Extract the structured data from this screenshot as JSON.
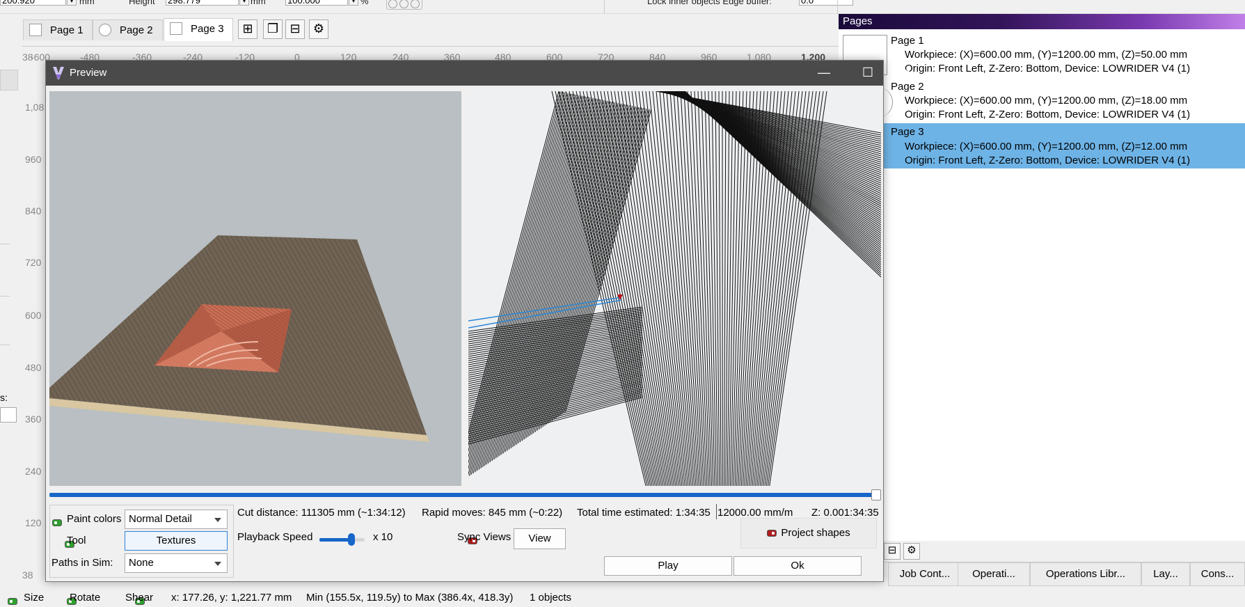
{
  "top_toolbar": {
    "x_value": "200.920",
    "x_unit": "mm",
    "height_label": "Height",
    "height_value": "298.779",
    "height_unit": "mm",
    "scale_value": "100.000",
    "scale_unit": "%",
    "lock_label": "Lock inner objects Edge buffer:",
    "lock_value": "0.0"
  },
  "page_tabs": [
    {
      "label": "Page 1"
    },
    {
      "label": "Page 2"
    },
    {
      "label": "Page 3"
    }
  ],
  "page_tab_buttons": [
    {
      "icon": "add-page-icon"
    },
    {
      "icon": "duplicate-page-icon"
    },
    {
      "icon": "remove-page-icon"
    },
    {
      "icon": "page-settings-icon"
    }
  ],
  "ruler": {
    "h_ticks": [
      "-600",
      "-480",
      "-360",
      "-240",
      "-120",
      "0",
      "120",
      "240",
      "360",
      "480",
      "600",
      "720",
      "840",
      "960",
      "1,080",
      "1,200"
    ],
    "v_ticks": [
      "1,08",
      "960",
      "840",
      "720",
      "600",
      "480",
      "360",
      "240",
      "120"
    ],
    "corner": "38",
    "bottom_corner": "38"
  },
  "left_fragment": {
    "label": "s:"
  },
  "preview": {
    "title": "Preview",
    "window_controls": {
      "minimize": "—",
      "maximize": "☐",
      "close": "✕"
    },
    "paint_colors_label": "Paint colors",
    "paint_colors_value": "Normal Detail",
    "tool_label": "Tool",
    "textures_button": "Textures",
    "paths_in_sim_label": "Paths in Sim:",
    "paths_in_sim_value": "None",
    "cut_distance": "Cut distance: 111305 mm (~1:34:12)",
    "rapid_moves": "Rapid moves: 845 mm (~0:22)",
    "total_time": "Total time estimated: 1:34:35",
    "feed_rate": "12000.00 mm/m",
    "z_readout": "Z: 0.001:34:35",
    "playback_speed_label": "Playback Speed",
    "playback_speed_value": "x 10",
    "playback_speed_level": 0.7,
    "sync_views_label": "Sync Views",
    "view_button": "View",
    "project_shapes_button": "Project shapes",
    "play_button": "Play",
    "ok_button": "Ok",
    "progress": 1.0,
    "colors": {
      "wood": "#6e6152",
      "pocket": "#c96f56",
      "accent": "#1766c9"
    }
  },
  "pages_panel": {
    "title": "Pages",
    "pages": [
      {
        "name": "Page 1",
        "workpiece": "Workpiece: (X)=600.00 mm, (Y)=1200.00 mm, (Z)=50.00 mm",
        "origin": "Origin: Front Left, Z-Zero: Bottom, Device: LOWRIDER V4 (1)",
        "selected": false
      },
      {
        "name": "Page 2",
        "workpiece": "Workpiece: (X)=600.00 mm, (Y)=1200.00 mm, (Z)=18.00 mm",
        "origin": "Origin: Front Left, Z-Zero: Bottom, Device: LOWRIDER V4 (1)",
        "selected": false
      },
      {
        "name": "Page 3",
        "workpiece": "Workpiece: (X)=600.00 mm, (Y)=1200.00 mm, (Z)=12.00 mm",
        "origin": "Origin: Front Left, Z-Zero: Bottom, Device: LOWRIDER V4 (1)",
        "selected": true
      }
    ]
  },
  "bottom_tabs": [
    {
      "label": "Job Cont..."
    },
    {
      "label": "Operati..."
    },
    {
      "label": "Operations Libr..."
    },
    {
      "label": "Lay..."
    },
    {
      "label": "Cons..."
    }
  ],
  "statusbar": {
    "size_label": "Size",
    "rotate_label": "Rotate",
    "shear_label": "Shear",
    "coords": "x: 177.26, y: 1,221.77 mm",
    "bounds": "Min (155.5x, 119.5y) to Max (386.4x, 418.3y)",
    "objects": "1 objects"
  }
}
